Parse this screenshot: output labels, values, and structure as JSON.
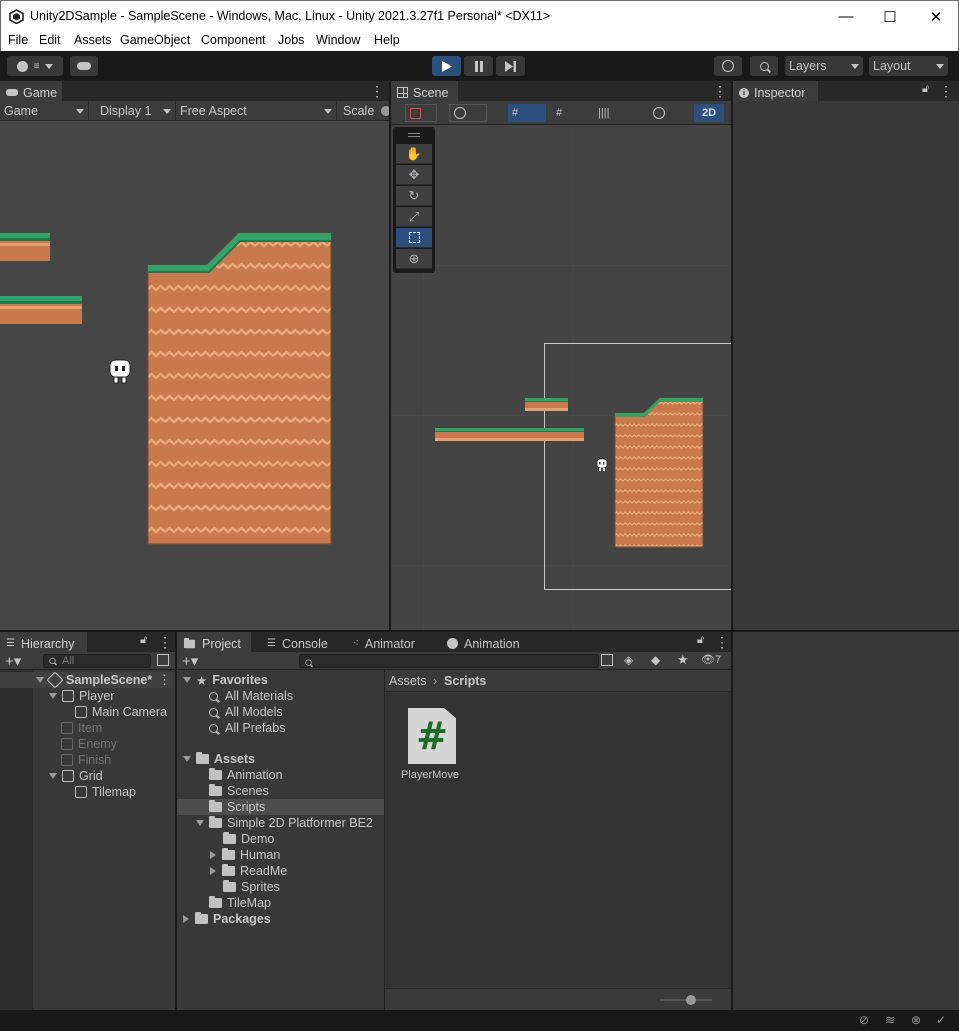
{
  "window": {
    "title": "Unity2DSample - SampleScene - Windows, Mac, Linux - Unity 2021.3.27f1 Personal* <DX11>",
    "minimize": "—",
    "maximize": "☐",
    "close": "✕"
  },
  "menu": [
    "File",
    "Edit",
    "Assets",
    "GameObject",
    "Component",
    "Jobs",
    "Window",
    "Help"
  ],
  "toolbar": {
    "account_icon": "account-icon",
    "cloud_icon": "cloud-icon",
    "play_icon": "play-icon",
    "pause_icon": "pause-icon",
    "step_icon": "step-icon",
    "history_icon": "history-icon",
    "search_icon": "search-icon",
    "layers": "Layers",
    "layout": "Layout"
  },
  "game": {
    "tab": "Game",
    "view_dropdown": "Game",
    "display": "Display 1",
    "aspect": "Free Aspect",
    "scale_label": "Scale"
  },
  "scene": {
    "tab": "Scene",
    "mode_2d": "2D",
    "tools": [
      "hand-tool-icon",
      "move-tool-icon",
      "rotate-tool-icon",
      "scale-tool-icon",
      "rect-tool-icon",
      "transform-tool-icon"
    ]
  },
  "inspector": {
    "tab": "Inspector"
  },
  "hierarchy": {
    "tab": "Hierarchy",
    "search_placeholder": "All",
    "items": [
      {
        "label": "SampleScene*",
        "depth": 0,
        "bold": true,
        "active": true
      },
      {
        "label": "Player",
        "depth": 1,
        "active": true
      },
      {
        "label": "Main Camera",
        "depth": 2,
        "active": true
      },
      {
        "label": "Item",
        "depth": 1,
        "active": false
      },
      {
        "label": "Enemy",
        "depth": 1,
        "active": false
      },
      {
        "label": "Finish",
        "depth": 1,
        "active": false
      },
      {
        "label": "Grid",
        "depth": 1,
        "active": true
      },
      {
        "label": "Tilemap",
        "depth": 2,
        "active": true
      }
    ]
  },
  "project": {
    "tabs": [
      "Project",
      "Console",
      "Animator",
      "Animation"
    ],
    "hidden_count": "7",
    "favorites": {
      "label": "Favorites",
      "items": [
        "All Materials",
        "All Models",
        "All Prefabs"
      ]
    },
    "tree": [
      {
        "label": "Assets",
        "depth": 0,
        "bold": true
      },
      {
        "label": "Animation",
        "depth": 1
      },
      {
        "label": "Scenes",
        "depth": 1
      },
      {
        "label": "Scripts",
        "depth": 1,
        "selected": true
      },
      {
        "label": "Simple 2D Platformer BE2",
        "depth": 1
      },
      {
        "label": "Demo",
        "depth": 2
      },
      {
        "label": "Human",
        "depth": 2
      },
      {
        "label": "ReadMe",
        "depth": 2
      },
      {
        "label": "Sprites",
        "depth": 2
      },
      {
        "label": "TileMap",
        "depth": 1
      },
      {
        "label": "Packages",
        "depth": 0,
        "bold": true
      }
    ],
    "breadcrumb": [
      "Assets",
      "Scripts"
    ],
    "breadcrumb_sep": "›",
    "asset": {
      "name": "PlayerMove",
      "glyph": "#"
    }
  },
  "colors": {
    "play_active": "#2c4f7c",
    "grass": "#35a26a",
    "dirt": "#c87a4c"
  }
}
